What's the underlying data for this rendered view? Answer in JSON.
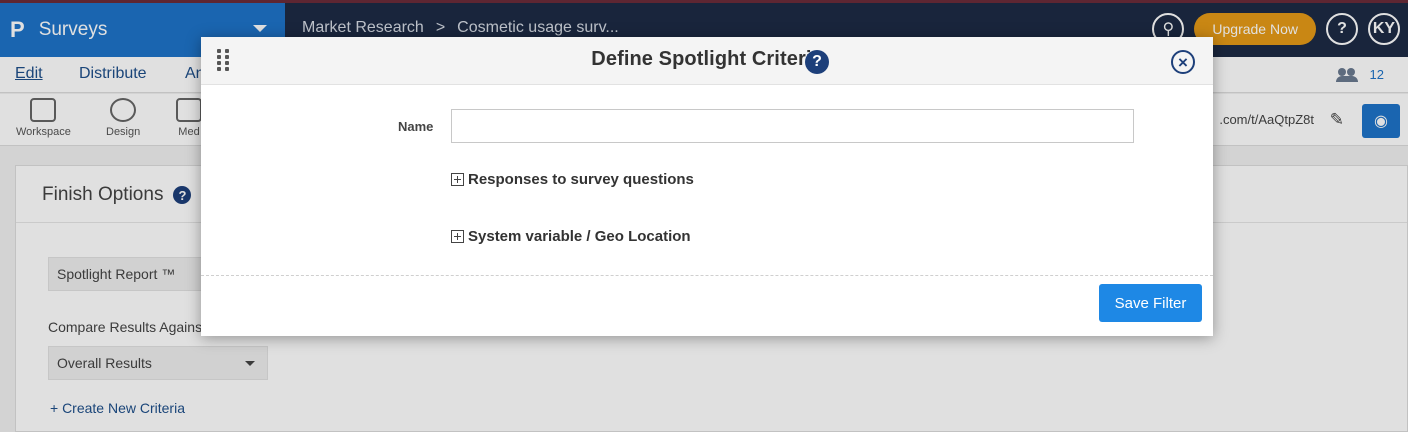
{
  "app": {
    "logo": "P",
    "name": "Surveys",
    "breadcrumb": [
      "Market Research",
      ">",
      "Cosmetic usage surv..."
    ],
    "upgrade_label": "Upgrade Now",
    "help_label": "?",
    "avatar_initials": "KY"
  },
  "menu": {
    "items": [
      "Edit",
      "Distribute",
      "An"
    ],
    "collaborators_count": "12"
  },
  "toolbar": {
    "tools": [
      "Workspace",
      "Design",
      "Med"
    ],
    "survey_url": ".com/t/AaQtpZ8t"
  },
  "background_panel": {
    "title": "Finish Options",
    "report_select": "Spotlight Report ™",
    "compare_label": "Compare Results Against",
    "compare_select": "Overall Results",
    "create_link": "+ Create New Criteria"
  },
  "modal": {
    "title": "Define Spotlight Criteria",
    "help": "?",
    "close": "×",
    "name_label": "Name",
    "name_value": "",
    "sections": [
      "Responses to survey questions",
      "System variable / Geo Location"
    ],
    "save_label": "Save Filter"
  },
  "colors": {
    "brand_blue": "#1e74c9",
    "top_nav": "#1d2b45",
    "upgrade": "#e59a17",
    "save_button": "#1e88e5",
    "icon_navy": "#1d3f7a"
  }
}
